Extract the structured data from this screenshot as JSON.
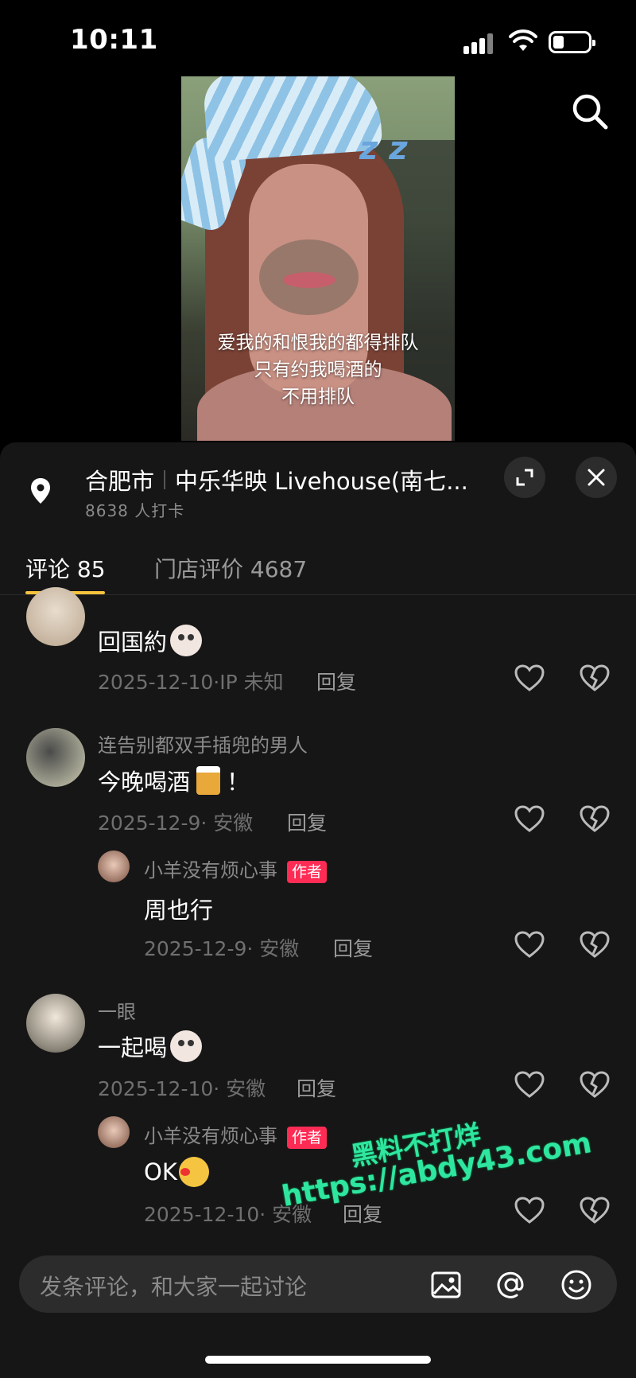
{
  "status": {
    "time": "10:11"
  },
  "video": {
    "caption_lines": [
      "爱我的和恨我的都得排队",
      "只有约我喝酒的",
      "不用排队"
    ]
  },
  "location": {
    "city": "合肥市",
    "venue": "中乐华映 Livehouse(南七...",
    "checkins": "8638 人打卡"
  },
  "tabs": [
    {
      "label": "评论 85",
      "active": true
    },
    {
      "label": "门店评价 4687",
      "active": false
    }
  ],
  "comments": [
    {
      "content": "回国約",
      "emoji": "cat-face",
      "meta": "2025-12-10·IP 未知",
      "reply_label": "回复"
    },
    {
      "username": "连告别都双手插兜的男人",
      "content": "今晚喝酒",
      "emoji": "beer-mug",
      "content_suffix": "！",
      "meta": "2025-12-9· 安徽",
      "reply_label": "回复",
      "replies": [
        {
          "username": "小羊没有烦心事",
          "badge": "作者",
          "content": "周也行",
          "meta": "2025-12-9· 安徽",
          "reply_label": "回复"
        }
      ]
    },
    {
      "username": "一眼",
      "content": "一起喝",
      "emoji": "cat-face",
      "meta": "2025-12-10· 安徽",
      "reply_label": "回复",
      "replies": [
        {
          "username": "小羊没有烦心事",
          "badge": "作者",
          "content": "OK",
          "emoji": "kissing-face",
          "meta": "2025-12-10· 安徽",
          "reply_label": "回复"
        }
      ]
    }
  ],
  "watermark": {
    "line1": "黑料不打烊",
    "line2": "https://abdy43.com"
  },
  "input": {
    "placeholder": "发条评论，和大家一起讨论"
  },
  "icons": {
    "search": "search-icon",
    "location": "location-pin-icon",
    "expand": "expand-icon",
    "close": "close-icon",
    "like": "heart-icon",
    "dislike": "broken-heart-icon",
    "image": "image-icon",
    "mention": "at-icon",
    "emoji": "smiley-icon"
  },
  "colors": {
    "author_badge": "#fe2c55",
    "tab_underline": "#f7c23d",
    "watermark": "#2fe6a0"
  }
}
